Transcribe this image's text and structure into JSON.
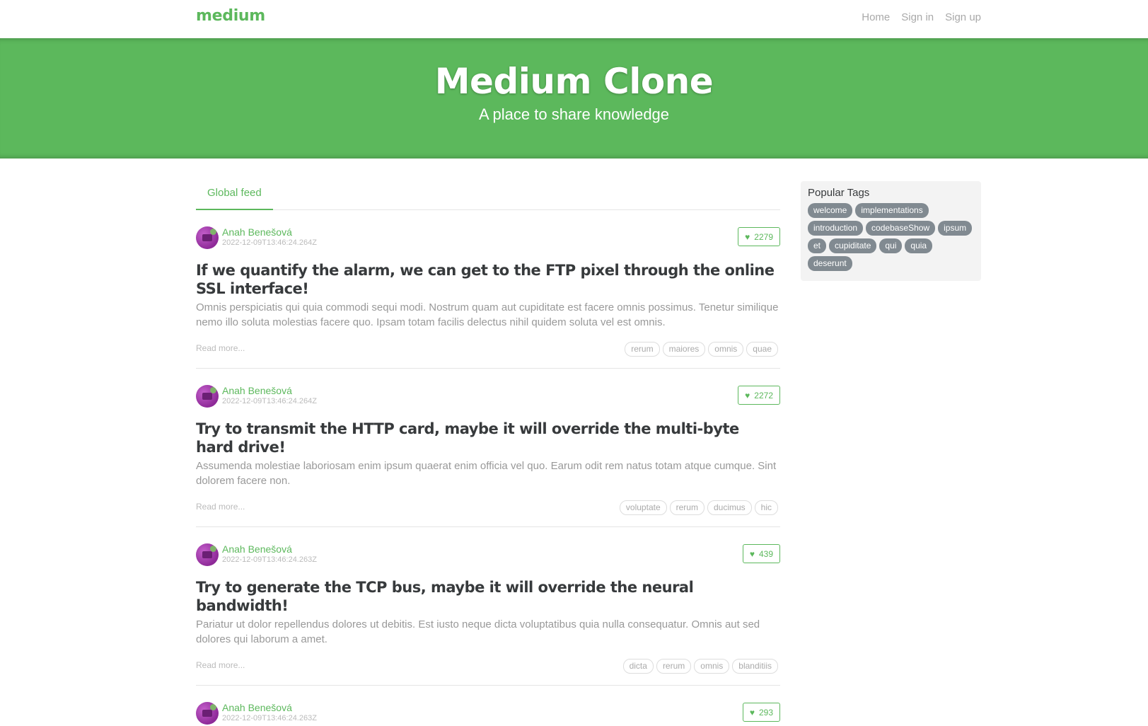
{
  "navbar": {
    "brand": "medium",
    "links": [
      "Home",
      "Sign in",
      "Sign up"
    ]
  },
  "banner": {
    "title": "Medium Clone",
    "subtitle": "A place to share knowledge"
  },
  "feed": {
    "tab_label": "Global feed",
    "read_more": "Read more...",
    "articles": [
      {
        "author": "Anah Benešová",
        "date": "2022-12-09T13:46:24.264Z",
        "likes": "2279",
        "title": "If we quantify the alarm, we can get to the FTP pixel through the online SSL interface!",
        "description": "Omnis perspiciatis qui quia commodi sequi modi. Nostrum quam aut cupiditate est facere omnis possimus. Tenetur similique nemo illo soluta molestias facere quo. Ipsam totam facilis delectus nihil quidem soluta vel est omnis.",
        "tags": [
          "rerum",
          "maiores",
          "omnis",
          "quae"
        ]
      },
      {
        "author": "Anah Benešová",
        "date": "2022-12-09T13:46:24.264Z",
        "likes": "2272",
        "title": "Try to transmit the HTTP card, maybe it will override the multi-byte hard drive!",
        "description": "Assumenda molestiae laboriosam enim ipsum quaerat enim officia vel quo. Earum odit rem natus totam atque cumque. Sint dolorem facere non.",
        "tags": [
          "voluptate",
          "rerum",
          "ducimus",
          "hic"
        ]
      },
      {
        "author": "Anah Benešová",
        "date": "2022-12-09T13:46:24.263Z",
        "likes": "439",
        "title": "Try to generate the TCP bus, maybe it will override the neural bandwidth!",
        "description": "Pariatur ut dolor repellendus dolores ut debitis. Est iusto neque dicta voluptatibus quia nulla consequatur. Omnis aut sed dolores qui laborum a amet.",
        "tags": [
          "dicta",
          "rerum",
          "omnis",
          "blanditiis"
        ]
      },
      {
        "author": "Anah Benešová",
        "date": "2022-12-09T13:46:24.263Z",
        "likes": "293",
        "title": "",
        "description": "",
        "tags": []
      }
    ]
  },
  "sidebar": {
    "title": "Popular Tags",
    "tags": [
      "welcome",
      "implementations",
      "introduction",
      "codebaseShow",
      "ipsum",
      "et",
      "cupiditate",
      "qui",
      "quia",
      "deserunt"
    ]
  },
  "colors": {
    "accent": "#5cb85c",
    "tag_pill": "#818a91"
  }
}
